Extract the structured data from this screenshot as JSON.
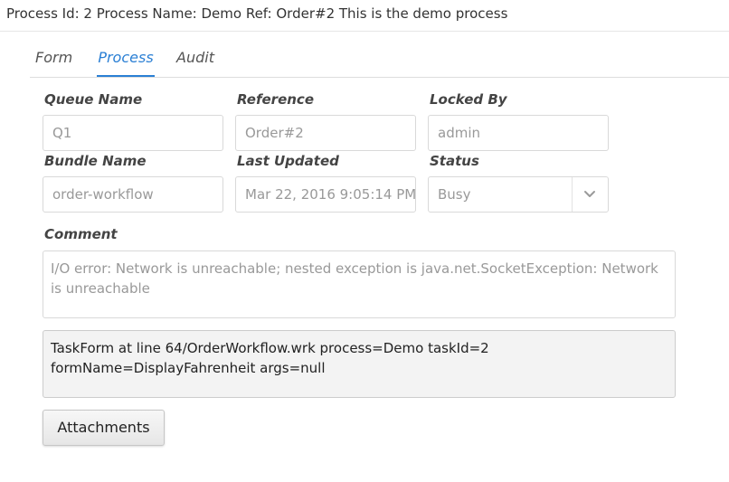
{
  "header": {
    "title": "Process Id: 2 Process Name: Demo Ref: Order#2 This is the demo process"
  },
  "tabs": [
    {
      "label": "Form",
      "active": false
    },
    {
      "label": "Process",
      "active": true
    },
    {
      "label": "Audit",
      "active": false
    }
  ],
  "fields": {
    "queue_name": {
      "label": "Queue Name",
      "value": "Q1"
    },
    "reference": {
      "label": "Reference",
      "value": "Order#2"
    },
    "locked_by": {
      "label": "Locked By",
      "value": "admin"
    },
    "bundle_name": {
      "label": "Bundle Name",
      "value": "order-workflow"
    },
    "last_updated": {
      "label": "Last Updated",
      "value": "Mar 22, 2016 9:05:14 PM"
    },
    "status": {
      "label": "Status",
      "value": "Busy",
      "icon": "chevron-down-icon"
    }
  },
  "comment": {
    "label": "Comment",
    "value": "I/O error: Network is unreachable; nested exception is java.net.SocketException: Network is unreachable"
  },
  "task_info": {
    "value": "TaskForm at line 64/OrderWorkflow.wrk process=Demo taskId=2 formName=DisplayFahrenheit args=null"
  },
  "actions": {
    "attachments_label": "Attachments"
  },
  "colors": {
    "accent": "#2a7fd4",
    "border": "#d9d9d9",
    "readonly_bg": "#f3f3f3"
  }
}
